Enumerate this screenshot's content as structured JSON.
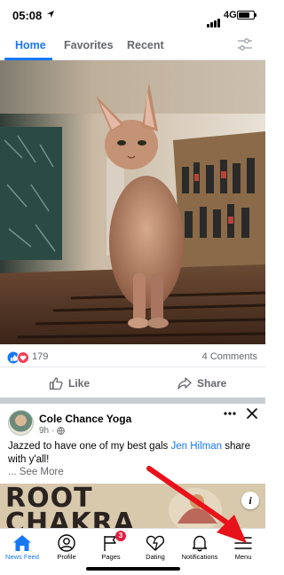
{
  "status_bar": {
    "time": "05:08",
    "network": "4G"
  },
  "tabs": [
    {
      "label": "Home",
      "active": true
    },
    {
      "label": "Favorites",
      "active": false
    },
    {
      "label": "Recent",
      "active": false
    }
  ],
  "post1": {
    "reaction_count": "179",
    "comments_label": "4 Comments",
    "like_label": "Like",
    "share_label": "Share"
  },
  "post2": {
    "author": "Cole Chance Yoga",
    "time": "9h",
    "text_before": "Jazzed to have one of my best gals ",
    "mention": "Jen Hilman",
    "text_after": " share with y'all!",
    "see_more": "... See More",
    "image_text_line1": "ROOT",
    "image_text_line2": "CHAKRA"
  },
  "bottom_nav": [
    {
      "label": "News Feed",
      "icon": "home-icon",
      "active": true
    },
    {
      "label": "Profile",
      "icon": "profile-icon",
      "active": false
    },
    {
      "label": "Pages",
      "icon": "flag-icon",
      "active": false,
      "badge": "3"
    },
    {
      "label": "Dating",
      "icon": "heart-icon",
      "active": false
    },
    {
      "label": "Notifications",
      "icon": "bell-icon",
      "active": false
    },
    {
      "label": "Menu",
      "icon": "menu-icon",
      "active": false
    }
  ],
  "colors": {
    "brand": "#1877f2",
    "text": "#050505",
    "secondary": "#65676b",
    "badge": "#e41e3f",
    "annotation_arrow": "#e8121a"
  }
}
